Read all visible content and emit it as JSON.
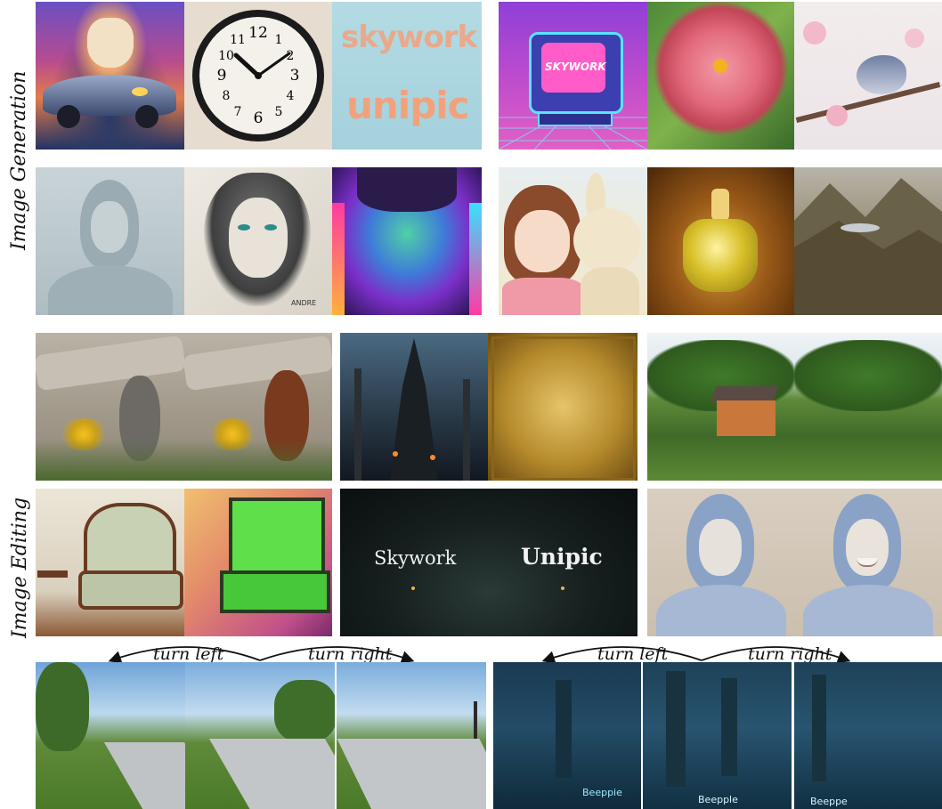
{
  "section_labels": {
    "generation": "Image Generation",
    "editing": "Image Editing"
  },
  "tile_text": {
    "skywork_word": "skywork",
    "unipic_word": "unipic",
    "monitor_text": "SKYWORK",
    "forest_left": "Skywork",
    "forest_right": "Unipic",
    "sketch_signature": "ANDRE",
    "city_sign_1": "Beeppie",
    "city_sign_2": "Beepple",
    "city_sign_3": "Beeppe"
  },
  "arrows": {
    "left_group": {
      "left": "turn left",
      "right": "turn right"
    },
    "right_group": {
      "left": "turn left",
      "right": "turn right"
    }
  },
  "colors": {
    "label": "#111111",
    "forest_text": "#f2f2f2"
  }
}
